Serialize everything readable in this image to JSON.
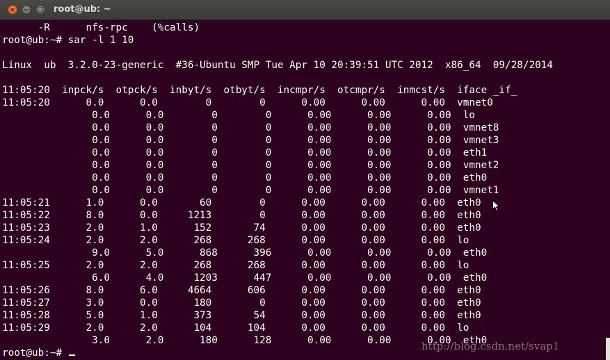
{
  "window": {
    "title": "root@ub: ~",
    "close_glyph": "×",
    "minimize_glyph": "−",
    "maximize_glyph": "□"
  },
  "terminal": {
    "lines": [
      "      -R      nfs-rpc    (%calls)",
      "root@ub:~# sar -l 1 10",
      "",
      "Linux  ub  3.2.0-23-generic  #36-Ubuntu SMP Tue Apr 10 20:39:51 UTC 2012  x86_64  09/28/2014",
      "",
      "11:05:20  inpck/s  otpck/s  inbyt/s  otbyt/s  incmpr/s  otcmpr/s  inmcst/s  iface _if_",
      "11:05:20      0.0      0.0        0        0      0.00      0.00      0.00  vmnet0",
      "               0.0      0.0        0        0      0.00      0.00      0.00  lo",
      "               0.0      0.0        0        0      0.00      0.00      0.00  vmnet8",
      "               0.0      0.0        0        0      0.00      0.00      0.00  vmnet3",
      "               0.0      0.0        0        0      0.00      0.00      0.00  eth1",
      "               0.0      0.0        0        0      0.00      0.00      0.00  vmnet2",
      "               0.0      0.0        0        0      0.00      0.00      0.00  eth0",
      "               0.0      0.0        0        0      0.00      0.00      0.00  vmnet1",
      "11:05:21      1.0      0.0       60        0      0.00      0.00      0.00  eth0",
      "11:05:22      8.0      0.0     1213        0      0.00      0.00      0.00  eth0",
      "11:05:23      2.0      1.0      152       74      0.00      0.00      0.00  eth0",
      "11:05:24      2.0      2.0      268      268      0.00      0.00      0.00  lo",
      "               9.0      5.0      868      396      0.00      0.00      0.00  eth0",
      "11:05:25      2.0      2.0      268      268      0.00      0.00      0.00  lo",
      "               6.0      4.0     1203      447      0.00      0.00      0.00  eth0",
      "11:05:26      8.0      6.0     4664      606      0.00      0.00      0.00  eth0",
      "11:05:27      3.0      0.0      180        0      0.00      0.00      0.00  eth0",
      "11:05:28      5.0      1.0      373       54      0.00      0.00      0.00  eth0",
      "11:05:29      2.0      2.0      104      104      0.00      0.00      0.00  lo",
      "               3.0      2.0      180      128      0.00      0.00      0.00  eth0"
    ],
    "prompt": "root@ub:~# "
  },
  "watermark": "http://blog.csdn.net/svap1",
  "colors": {
    "background": "#2c001e",
    "text": "#ffffff",
    "close_button": "#e05a24"
  }
}
